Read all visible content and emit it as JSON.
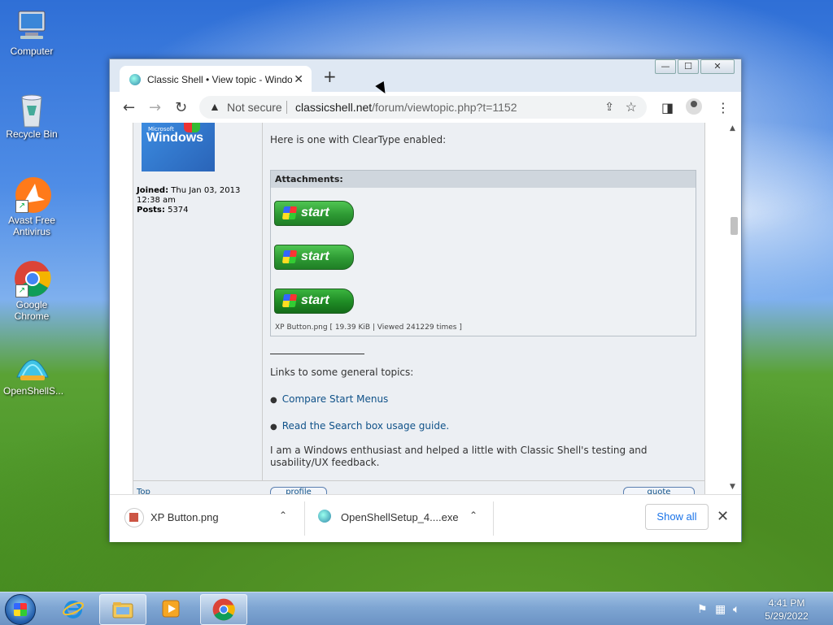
{
  "desktop": {
    "icons": [
      {
        "label": "Computer"
      },
      {
        "label": "Recycle Bin"
      },
      {
        "label": "Avast Free Antivirus"
      },
      {
        "label": "Google Chrome"
      },
      {
        "label": "OpenShellS..."
      }
    ]
  },
  "browser": {
    "tab_title": "Classic Shell • View topic - Windows",
    "tab_close": "✕",
    "new_tab": "+",
    "window_buttons": {
      "minimize": "—",
      "maximize": "☐",
      "close": "✕"
    },
    "address": {
      "security_label": "Not secure",
      "host": "classicshell.net",
      "path": "/forum/viewtopic.php?t=1152"
    }
  },
  "post": {
    "avatar_text": {
      "microsoft": "Microsoft",
      "windows": "Windows"
    },
    "profile": {
      "joined_label": "Joined:",
      "joined_value": "Thu Jan 03, 2013 12:38 am",
      "posts_label": "Posts:",
      "posts_value": "5374"
    },
    "intro": "Here is one with ClearType enabled:",
    "attachments": {
      "header": "Attachments:",
      "buttons": [
        "start",
        "start",
        "start"
      ],
      "caption": "XP Button.png [ 19.39 KiB | Viewed 241229 times ]"
    },
    "signature": {
      "links_header": "Links to some general topics:",
      "links": [
        "Compare Start Menus",
        "Read the Search box usage guide."
      ],
      "bio": "I am a Windows enthusiast and helped a little with Classic Shell's testing and usability/UX feedback."
    },
    "footer": {
      "top": "Top",
      "profile": "profile",
      "quote": "quote"
    }
  },
  "downloads": {
    "items": [
      {
        "name": "XP Button.png"
      },
      {
        "name": "OpenShellSetup_4....exe"
      }
    ],
    "show_all": "Show all",
    "close": "✕"
  },
  "taskbar": {
    "clock_time": "4:41 PM",
    "clock_date": "5/29/2022"
  },
  "colors": {
    "link": "#105289",
    "accent": "#1a73e8"
  }
}
